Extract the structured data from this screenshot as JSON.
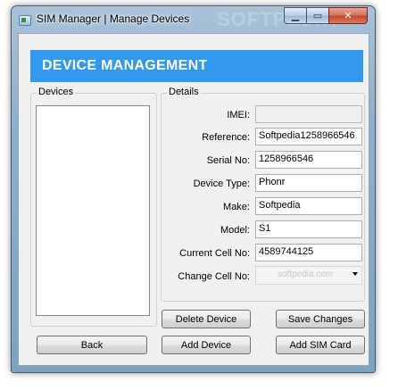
{
  "window": {
    "title": "SIM Manager | Manage Devices",
    "watermark": "SOFTPEDIA",
    "controls": {
      "minimize": "▁",
      "maximize": "▭",
      "close": "✕"
    }
  },
  "banner": {
    "title": "DEVICE MANAGEMENT"
  },
  "devices": {
    "label": "Devices",
    "items": []
  },
  "details": {
    "label": "Details",
    "imei": {
      "label": "IMEI:",
      "value": ""
    },
    "reference": {
      "label": "Reference:",
      "value": "Softpedia1258966546"
    },
    "serial": {
      "label": "Serial No:",
      "value": "1258966546"
    },
    "device_type": {
      "label": "Device Type:",
      "value": "Phonr"
    },
    "make": {
      "label": "Make:",
      "value": "Softpedia"
    },
    "model": {
      "label": "Model:",
      "value": "S1"
    },
    "current_cell": {
      "label": "Current Cell No:",
      "value": "4589744125"
    },
    "change_cell": {
      "label": "Change Cell No:",
      "value": "",
      "watermark": "softpedia.com"
    }
  },
  "buttons": {
    "back": "Back",
    "delete_device": "Delete Device",
    "save_changes": "Save Changes",
    "add_device": "Add Device",
    "add_sim_card": "Add SIM Card"
  },
  "colors": {
    "banner": "#3399ee",
    "banner_text": "#ffffff",
    "close_button": "#c2462c"
  }
}
